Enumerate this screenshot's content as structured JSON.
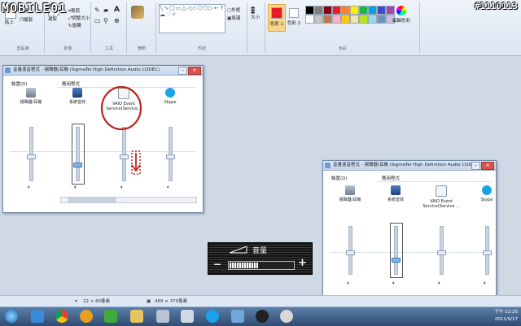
{
  "watermark": "MOBILE01",
  "post_id": "#1110113",
  "ribbon": {
    "clipboard": {
      "paste": "貼上",
      "cut": "剪下",
      "copy": "複製",
      "label": "剪貼簿"
    },
    "image": {
      "select": "選取",
      "crop": "裁剪",
      "resize": "調整大小",
      "rotate": "旋轉",
      "label": "影像"
    },
    "tools": {
      "label": "工具"
    },
    "brushes": {
      "label": "筆刷"
    },
    "shapes": {
      "outline": "外框",
      "fill": "填滿",
      "label": "形狀"
    },
    "size": {
      "label": "大小"
    },
    "colors": {
      "color1": "色彩 1",
      "color2": "色彩 2",
      "edit": "編輯色彩",
      "label": "色彩",
      "palette": [
        "#000000",
        "#7f7f7f",
        "#880015",
        "#ed1c24",
        "#ff7f27",
        "#fff200",
        "#22b14c",
        "#00a2e8",
        "#3f48cc",
        "#a349a4",
        "#ffffff",
        "#c3c3c3",
        "#b97a57",
        "#ffaec9",
        "#ffc90e",
        "#efe4b0",
        "#b5e61d",
        "#99d9ea",
        "#7092be",
        "#c8bfe7"
      ],
      "current1": "#ed1c24",
      "current2": "#ffffff"
    }
  },
  "mixer_left": {
    "title": "音量混音程式 - 揚聲器/耳機 (SigmaTel High Definition Audio CODEC)",
    "device_header": "裝置(D)",
    "apps_header": "應用程式",
    "channels": [
      {
        "name": "揚聲器/耳機",
        "icon": "speaker-device-icon",
        "level": 0.45
      },
      {
        "name": "系統音效",
        "icon": "system-sounds-icon",
        "level": 0.3
      },
      {
        "name": "VAIO Event Service(Service...",
        "icon": "vaio-service-icon",
        "level": 0.45,
        "highlighted": true
      },
      {
        "name": "Skype",
        "icon": "skype-icon",
        "level": 0.45
      }
    ]
  },
  "mixer_right": {
    "title": "音量混音程式 - 揚聲器/耳機 (SigmaTel High Definition Audio CODEC)",
    "device_header": "裝置(D)",
    "apps_header": "應用程式",
    "channels": [
      {
        "name": "揚聲器/耳機",
        "icon": "speaker-device-icon",
        "level": 0.45
      },
      {
        "name": "系統音效",
        "icon": "system-sounds-icon",
        "level": 0.3
      },
      {
        "name": "VAIO Event Service(Service ...",
        "icon": "vaio-service-icon",
        "level": 0.45
      },
      {
        "name": "Skype",
        "icon": "skype-icon",
        "level": 0.45
      }
    ]
  },
  "volume_osd": {
    "label": "音量",
    "level": 0.45,
    "minus": "−",
    "plus": "+"
  },
  "statusbar": {
    "selection_size": "22 × 60像素",
    "canvas_size": "489 × 370像素"
  },
  "taskbar": {
    "time": "下午 12:25",
    "date": "2011/9/17",
    "icons": [
      "start-orb-icon",
      "ie-icon",
      "chrome-icon",
      "media-icon",
      "green-app-icon",
      "folder-icon",
      "calculator-icon",
      "paint-icon",
      "skype-icon",
      "network-icon",
      "qq-icon",
      "disc-icon"
    ]
  }
}
